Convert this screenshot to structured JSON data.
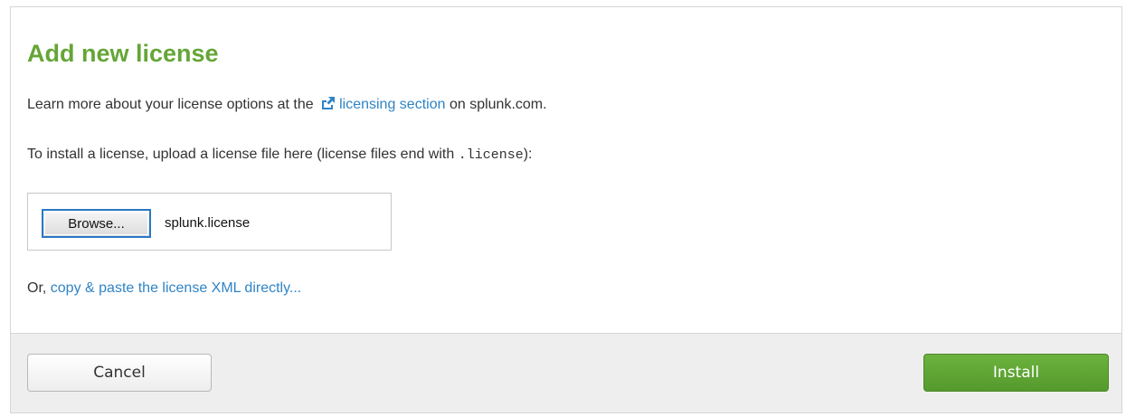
{
  "dialog": {
    "title": "Add new license",
    "learn_more": {
      "prefix": "Learn more about your license options at the ",
      "link_text": "licensing section",
      "suffix": " on splunk.com.",
      "link_icon": "external-link-icon"
    },
    "install_instructions": {
      "prefix": "To install a license, upload a license file here (license files end with ",
      "extension": ".license",
      "suffix": "):"
    },
    "file_input": {
      "browse_label": "Browse...",
      "selected_file": "splunk.license"
    },
    "paste_option": {
      "prefix": "Or, ",
      "link_text": "copy & paste the license XML directly..."
    },
    "footer": {
      "cancel_label": "Cancel",
      "install_label": "Install"
    }
  },
  "colors": {
    "title_green": "#65a637",
    "link_blue": "#2f84c6",
    "install_green": "#5ea333",
    "footer_bg": "#eeeeee"
  }
}
